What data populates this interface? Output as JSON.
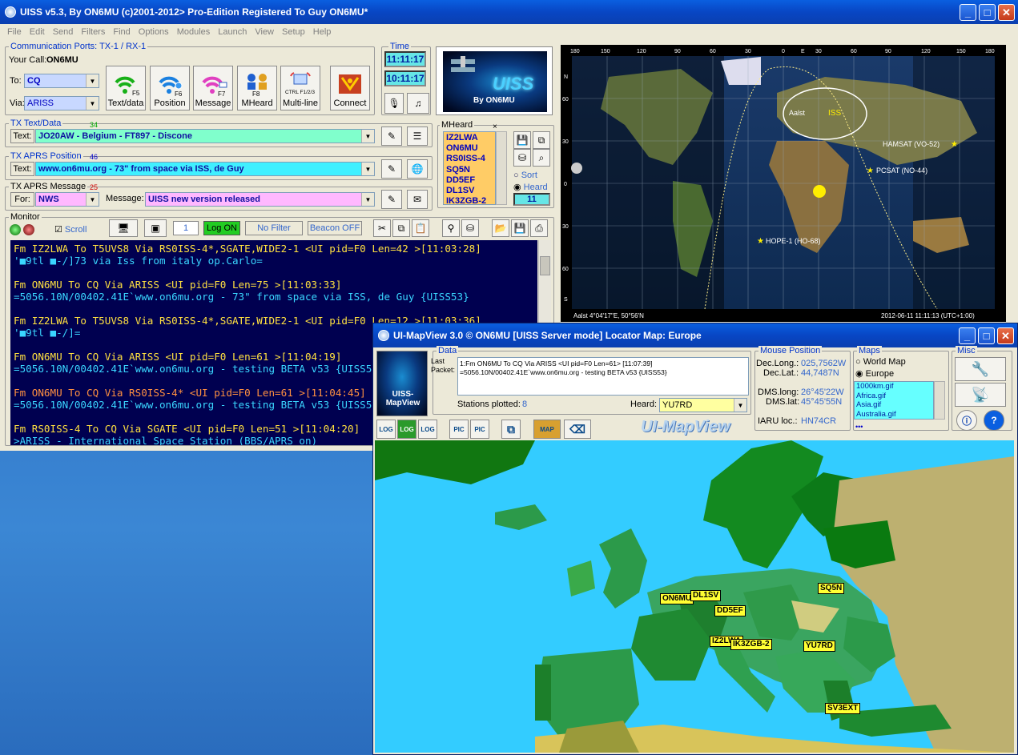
{
  "main_window": {
    "title": "UISS v5.3, By ON6MU (c)2001-2012> Pro-Edition Registered To Guy ON6MU*",
    "menu": [
      "File",
      "Edit",
      "Send",
      "Filters",
      "Find",
      "Options",
      "Modules",
      "Launch",
      "View",
      "Setup",
      "Help"
    ],
    "comm_ports_label": "Communication Ports: TX-1 / RX-1",
    "your_call_label": "Your Call:",
    "your_call": "ON6MU",
    "to_label": "To:",
    "to_value": "CQ",
    "via_label": "Via:",
    "via_value": "ARISS",
    "buttons": {
      "text_data": {
        "key": "F5",
        "label": "Text/data"
      },
      "position": {
        "key": "F6",
        "label": "Position"
      },
      "message": {
        "key": "F7",
        "label": "Message"
      },
      "mheard": {
        "key": "F8",
        "label": "MHeard"
      },
      "multiline": {
        "key": "CTRL F1/2/3",
        "label": "Multi-line"
      },
      "connect": {
        "label": "Connect"
      }
    },
    "time_label": "Time",
    "time1": "11:11:17",
    "time2": "10:11:17",
    "logo_text": "UISS",
    "logo_sub": "By ON6MU",
    "tx_text": {
      "legend": "TX Text/Data",
      "count": "34",
      "field_label": "Text:",
      "value": "JO20AW - Belgium - FT897 - Discone"
    },
    "tx_pos": {
      "legend": "TX APRS Position",
      "count": "46",
      "field_label": "Text:",
      "value": "www.on6mu.org - 73\" from space via ISS, de Guy"
    },
    "tx_msg": {
      "legend": "TX APRS Message",
      "count": "25",
      "for_label": "For:",
      "for_value": "NWS",
      "msg_label": "Message:",
      "msg_value": "UISS new version released"
    },
    "mheard": {
      "legend": "MHeard",
      "close": "×",
      "items": [
        "IZ2LWA",
        "ON6MU",
        "RS0ISS-4",
        "SQ5N",
        "DD5EF",
        "DL1SV",
        "IK3ZGB-2"
      ],
      "sort_label": "Sort",
      "heard_label": "Heard",
      "count": "11"
    },
    "monitor": {
      "legend": "Monitor",
      "scroll_label": "Scroll",
      "page_value": "1",
      "log_on": "Log ON",
      "no_filter": "No Filter",
      "beacon_off": "Beacon OFF"
    },
    "terminal_lines": [
      {
        "c": "yl",
        "t": "Fm IZ2LWA To T5UVS8 Via RS0ISS-4*,SGATE,WIDE2-1 <UI pid=F0 Len=42 >[11:03:28]"
      },
      {
        "c": "cy",
        "t": "'■9tl ■-/]73 via Iss from italy op.Carlo="
      },
      {
        "c": "bl",
        "t": ""
      },
      {
        "c": "yl",
        "t": "Fm ON6MU To CQ Via ARISS <UI pid=F0 Len=75 >[11:03:33]"
      },
      {
        "c": "cy",
        "t": "=5056.10N/00402.41E`www.on6mu.org - 73\" from space via ISS, de Guy {UISS53}"
      },
      {
        "c": "bl",
        "t": ""
      },
      {
        "c": "yl",
        "t": "Fm IZ2LWA To T5UVS8 Via RS0ISS-4*,SGATE,WIDE2-1 <UI pid=F0 Len=12 >[11:03:36]"
      },
      {
        "c": "cy",
        "t": "'■9tl ■-/]="
      },
      {
        "c": "bl",
        "t": ""
      },
      {
        "c": "yl",
        "t": "Fm ON6MU To CQ Via ARISS <UI pid=F0 Len=61 >[11:04:19]"
      },
      {
        "c": "cy",
        "t": "=5056.10N/00402.41E`www.on6mu.org - testing BETA v53 {UISS53}"
      },
      {
        "c": "bl",
        "t": ""
      },
      {
        "c": "or",
        "t": "Fm ON6MU To CQ Via RS0ISS-4* <UI pid=F0 Len=61 >[11:04:45]"
      },
      {
        "c": "cy",
        "t": "=5056.10N/00402.41E`www.on6mu.org - testing BETA v53 {UISS53}"
      },
      {
        "c": "bl",
        "t": ""
      },
      {
        "c": "yl",
        "t": "Fm RS0ISS-4 To CQ Via SGATE <UI pid=F0 Len=51 >[11:04:20]"
      },
      {
        "c": "cy",
        "t": ">ARISS - International Space Station (BBS/APRS on)"
      }
    ],
    "worldmap": {
      "top_ticks": [
        "180",
        "150",
        "120",
        "90",
        "60",
        "30",
        "0",
        "E",
        "30",
        "60",
        "90",
        "120",
        "150",
        "180"
      ],
      "left_ticks": [
        "N",
        "60",
        "30",
        "0",
        "30",
        "60",
        "S"
      ],
      "sats": [
        {
          "name": "ISS"
        },
        {
          "name": "Aalst"
        },
        {
          "name": "HAMSAT (VO-52)"
        },
        {
          "name": "PCSAT (NO-44)"
        },
        {
          "name": "HOPE-1 (HO-68)"
        }
      ],
      "status_left": "Aalst 4°04'17\"E, 50°56'N",
      "status_right": "2012-06-11 11:11:13 (UTC+1:00)"
    }
  },
  "map_window": {
    "title": "UI-MapView 3.0 © ON6MU  [UISS Server mode]  Locator Map: Europe",
    "logo_text": "UISS-MapView",
    "data": {
      "legend": "Data",
      "last_packet_label": "Last Packet:",
      "packet_line1": "1:Fm ON6MU To CQ Via ARISS <UI pid=F0 Len=61> [11:07:39]",
      "packet_line2": "=5056.10N/00402.41E`www.on6mu.org - testing BETA v53 {UISS53}",
      "stations_plotted_label": "Stations plotted:",
      "stations_plotted": "8",
      "heard_label": "Heard:",
      "heard_value": "YU7RD"
    },
    "mouse": {
      "legend": "Mouse Position",
      "dec_long_label": "Dec.Long.:",
      "dec_long": "025,7562W",
      "dec_lat_label": "Dec.Lat.:",
      "dec_lat": "44,7487N",
      "dms_long_label": "DMS.long:",
      "dms_long": "26°45'22W",
      "dms_lat_label": "DMS.lat:",
      "dms_lat": "45°45'55N",
      "iaru_label": "IARU loc.:",
      "iaru": "HN74CR"
    },
    "maps": {
      "legend": "Maps",
      "opt_world": "World Map",
      "opt_europe": "Europe",
      "files": [
        "1000km.gif",
        "Africa.gif",
        "Asia.gif",
        "Australia.gif"
      ],
      "more": "•••"
    },
    "misc": {
      "legend": "Misc"
    },
    "brand": "UI-MapView",
    "toolbar": {
      "log": "LOG",
      "pic": "PIC",
      "map": "MAP"
    },
    "stations": [
      {
        "name": "ON6MU"
      },
      {
        "name": "DL1SV"
      },
      {
        "name": "DD5EF"
      },
      {
        "name": "SQ5N"
      },
      {
        "name": "IZ2LWA"
      },
      {
        "name": "IK3ZGB-2"
      },
      {
        "name": "YU7RD"
      },
      {
        "name": "SV3EXT"
      }
    ]
  },
  "colors": {
    "terminal_bg": "#000050",
    "terminal_yellow": "#ffe040",
    "terminal_cyan": "#3ad6ff",
    "title_blue": "#0846c4",
    "sea": "#33ccff"
  }
}
